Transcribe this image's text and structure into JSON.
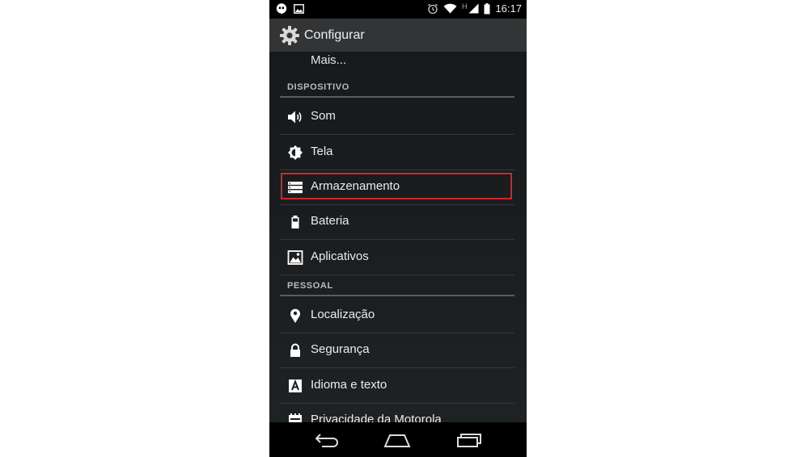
{
  "status_bar": {
    "time": "16:17",
    "network_type": "H",
    "icons": [
      "hangouts-icon",
      "image-icon",
      "alarm-icon",
      "wifi-icon",
      "signal-icon",
      "battery-icon"
    ]
  },
  "action_bar": {
    "title": "Configurar",
    "icon": "gear-icon"
  },
  "settings": {
    "partial_item": "Mais...",
    "sections": [
      {
        "header": "DISPOSITIVO",
        "items": [
          {
            "label": "Som",
            "icon": "speaker-icon"
          },
          {
            "label": "Tela",
            "icon": "brightness-icon"
          },
          {
            "label": "Armazenamento",
            "icon": "storage-icon",
            "highlighted": true
          },
          {
            "label": "Bateria",
            "icon": "battery-icon"
          },
          {
            "label": "Aplicativos",
            "icon": "apps-icon"
          }
        ]
      },
      {
        "header": "PESSOAL",
        "items": [
          {
            "label": "Localização",
            "icon": "location-icon"
          },
          {
            "label": "Segurança",
            "icon": "lock-icon"
          },
          {
            "label": "Idioma e texto",
            "icon": "language-icon"
          },
          {
            "label": "Privacidade da Motorola",
            "icon": "privacy-icon"
          }
        ]
      }
    ]
  },
  "colors": {
    "highlight": "#d0262d",
    "background": "#1c1e20",
    "action_bar": "#323436"
  },
  "nav_bar": {
    "buttons": [
      "back-icon",
      "home-icon",
      "recents-icon"
    ]
  }
}
